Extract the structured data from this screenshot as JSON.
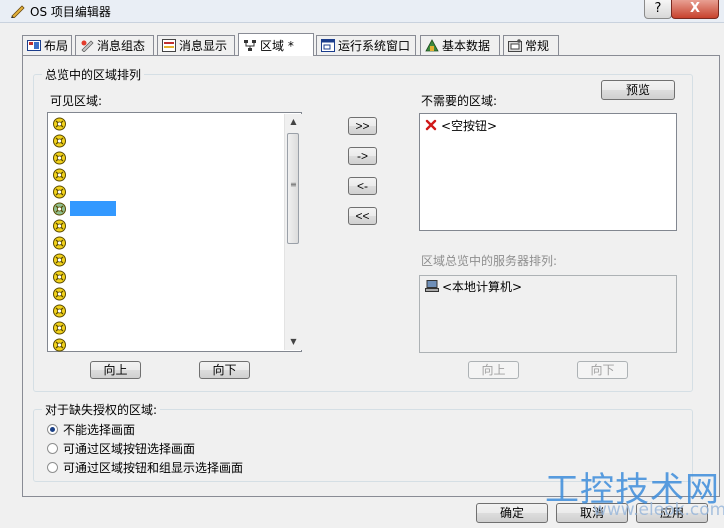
{
  "window": {
    "title": "OS 项目编辑器",
    "help_label": "?",
    "close_label": "X"
  },
  "tabs": [
    {
      "label": "布局",
      "icon": "layout-icon"
    },
    {
      "label": "消息组态",
      "icon": "message-config-icon"
    },
    {
      "label": "消息显示",
      "icon": "message-display-icon"
    },
    {
      "label": "区域  *",
      "icon": "area-tree-icon"
    },
    {
      "label": "运行系统窗口",
      "icon": "runtime-window-icon"
    },
    {
      "label": "基本数据",
      "icon": "basic-data-icon"
    },
    {
      "label": "常规",
      "icon": "general-icon"
    }
  ],
  "overview_group": {
    "legend": "总览中的区域排列",
    "visible_label": "可见区域:",
    "unneeded_label": "不需要的区域:",
    "preview_button": "预览",
    "move_all_right": ">>",
    "move_right": "->",
    "move_left": "<-",
    "move_all_left": "<<",
    "unneeded_items": [
      {
        "text": "<空按钮>",
        "icon": "red-x-icon"
      }
    ],
    "server_label": "区域总览中的服务器排列:",
    "server_items": [
      {
        "text": "<本地计算机>",
        "icon": "computer-icon"
      }
    ],
    "up_button": "向上",
    "down_button": "向下",
    "server_up_button": "向上",
    "server_down_button": "向下",
    "visible_rows": 14,
    "selected_row_index": 5
  },
  "missing_auth_group": {
    "legend": "对于缺失授权的区域:",
    "options": [
      {
        "label": "不能选择画面",
        "checked": true
      },
      {
        "label": "可通过区域按钮选择画面",
        "checked": false
      },
      {
        "label": "可通过区域按钮和组显示选择画面",
        "checked": false
      }
    ]
  },
  "footer": {
    "ok": "确定",
    "cancel": "取消",
    "apply": "应用"
  },
  "watermark": {
    "text": "工控技术网",
    "url": "www.eleok.com"
  },
  "colors": {
    "selection": "#3399ff",
    "accent_red": "#d01818",
    "watermark_blue": "#3d8ddb"
  }
}
